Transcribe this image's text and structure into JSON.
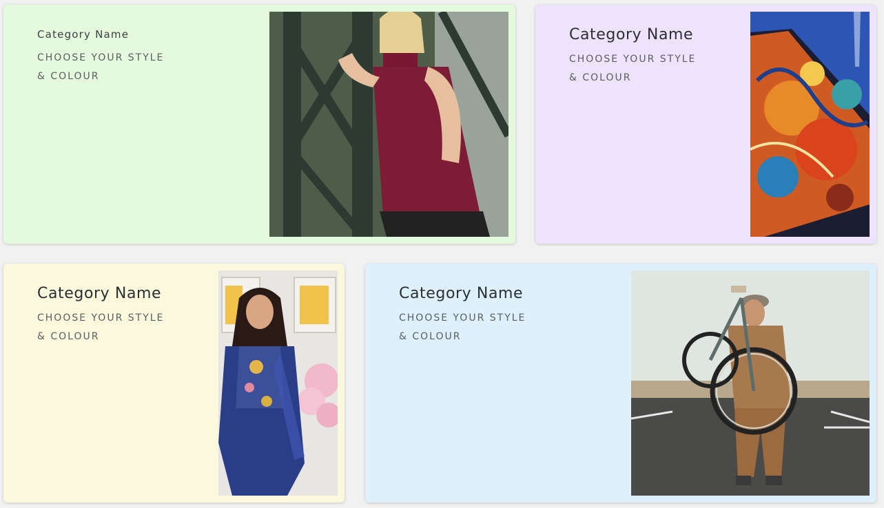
{
  "cards": [
    {
      "title": "Category Name",
      "line1": "CHOOSE YOUR STYLE",
      "line2": "& COLOUR",
      "bg": "#e5f9dd",
      "image": "woman-red-top-photo"
    },
    {
      "title": "Category Name",
      "line1": "CHOOSE YOUR STYLE",
      "line2": "& COLOUR",
      "bg": "#ede3fb",
      "image": "abstract-painting-photo"
    },
    {
      "title": "Category Name",
      "line1": "CHOOSE YOUR STYLE",
      "line2": "& COLOUR",
      "bg": "#faf8dd",
      "image": "woman-blue-dress-photo"
    },
    {
      "title": "Category Name",
      "line1": "CHOOSE YOUR STYLE",
      "line2": "& COLOUR",
      "bg": "#ddf0fb",
      "image": "man-with-bicycle-photo"
    }
  ]
}
